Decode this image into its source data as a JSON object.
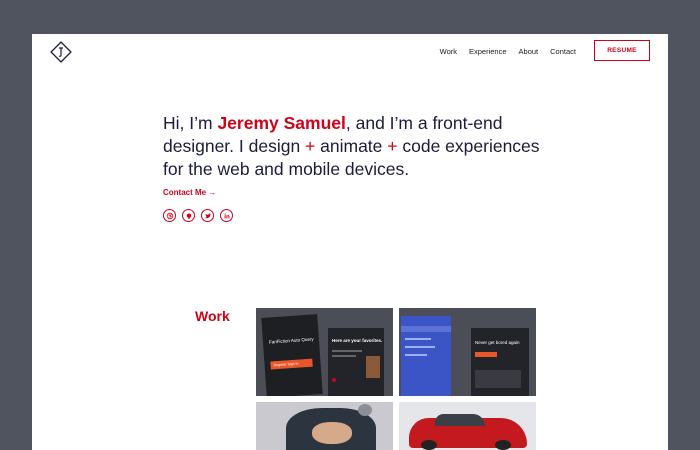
{
  "nav": {
    "links": [
      "Work",
      "Experience",
      "About",
      "Contact"
    ],
    "resume_label": "RESUME"
  },
  "hero": {
    "line1_pre": "Hi, I’m ",
    "name": "Jeremy Samuel",
    "line1_post": ", and I’m a front-end",
    "line2_pre": "designer. I design ",
    "plus1": "+",
    "line2_mid": " animate ",
    "plus2": "+",
    "line2_post": " code experiences",
    "line3": "for the web and mobile devices."
  },
  "contact_link": "Contact Me →",
  "socials": [
    "dribbble-icon",
    "github-icon",
    "twitter-icon",
    "linkedin-icon"
  ],
  "work": {
    "title": "Work",
    "thumb1": {
      "app_title": "FanFiction Auto Query",
      "button": "Register Sign In",
      "panel_title": "Here are your favorites."
    },
    "thumb2": {
      "headline": "Never get bored again"
    }
  },
  "colors": {
    "accent": "#d0021b",
    "text": "#1c1c3a",
    "frame": "#50545e"
  }
}
